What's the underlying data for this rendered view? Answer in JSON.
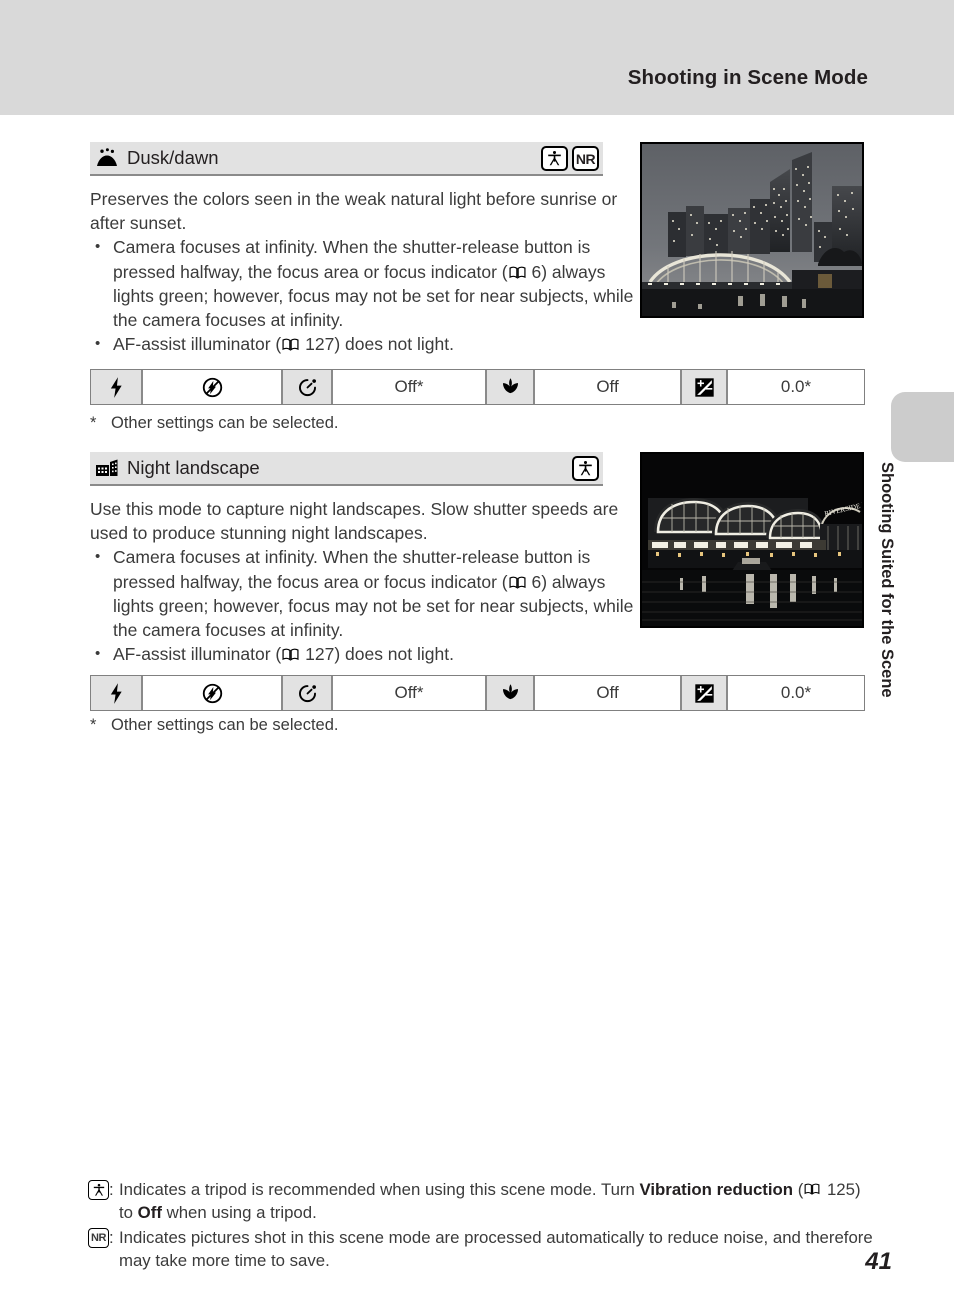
{
  "header": {
    "title": "Shooting in Scene Mode"
  },
  "side_tab": {
    "label": "Shooting Suited for the Scene"
  },
  "page_number": "41",
  "sections": [
    {
      "mode_icon": "dusk-dawn-icon",
      "title": "Dusk/dawn",
      "badges": [
        "tripod",
        "NR"
      ],
      "badge_nr_label": "NR",
      "description": "Preserves the colors seen in the weak natural light before sunrise or after sunset.",
      "bullets": [
        {
          "text_before": "Camera focuses at infinity. When the shutter-release button is pressed halfway, the focus area or focus indicator (",
          "page_ref": "6",
          "text_after": ") always lights green; however, focus may not be set for near subjects, while the camera focuses at infinity."
        },
        {
          "text_before": "AF-assist illuminator (",
          "page_ref": "127",
          "text_after": ") does not light."
        }
      ],
      "photo": {
        "name": "dusk-cityscape-photo",
        "alt": "Dusk cityscape with skyscrapers and an illuminated arched bridge over water"
      },
      "settings": [
        {
          "icon": "flash-icon",
          "value_icon": "flash-off-icon",
          "value": ""
        },
        {
          "icon": "self-timer-icon",
          "value": "Off*"
        },
        {
          "icon": "macro-icon",
          "value": "Off"
        },
        {
          "icon": "exposure-compensation-icon",
          "value": "0.0*"
        }
      ],
      "footnote": "Other settings can be selected.",
      "footnote_marker": "*"
    },
    {
      "mode_icon": "night-landscape-icon",
      "title": "Night landscape",
      "badges": [
        "tripod"
      ],
      "description": "Use this mode to capture night landscapes. Slow shutter speeds are used to produce stunning night landscapes.",
      "bullets": [
        {
          "text_before": "Camera focuses at infinity. When the shutter-release button is pressed halfway, the focus area or focus indicator (",
          "page_ref": "6",
          "text_after": ") always lights green; however, focus may not be set for near subjects, while the camera focuses at infinity."
        },
        {
          "text_before": "AF-assist illuminator (",
          "page_ref": "127",
          "text_after": ") does not light."
        }
      ],
      "photo": {
        "name": "night-riverside-photo",
        "alt": "Night photo of an illuminated riverside building with arched facades reflecting on water"
      },
      "settings": [
        {
          "icon": "flash-icon",
          "value_icon": "flash-off-icon",
          "value": ""
        },
        {
          "icon": "self-timer-icon",
          "value": "Off*"
        },
        {
          "icon": "macro-icon",
          "value": "Off"
        },
        {
          "icon": "exposure-compensation-icon",
          "value": "0.0*"
        }
      ],
      "footnote": "Other settings can be selected.",
      "footnote_marker": "*"
    }
  ],
  "notes": [
    {
      "badge": "tripod",
      "colon": ":",
      "part1": "Indicates a tripod is recommended when using this scene mode. Turn ",
      "bold1": "Vibration reduction",
      "part2": " (",
      "page_ref": "125",
      "part3": ") to ",
      "bold2": "Off",
      "part4": " when using a tripod."
    },
    {
      "badge": "NR",
      "badge_label": "NR",
      "colon": ":",
      "part1": "Indicates pictures shot in this scene mode are processed automatically to reduce noise, and therefore may take more time to save.",
      "bold1": "",
      "part2": "",
      "page_ref": "",
      "part3": "",
      "bold2": "",
      "part4": ""
    }
  ],
  "colors": {
    "header_band": "#d9d9d9",
    "title_bar": "#e2e2e2",
    "side_tab": "#cccccc",
    "rule": "#8a8a8a",
    "text": "#3b3b3b"
  }
}
